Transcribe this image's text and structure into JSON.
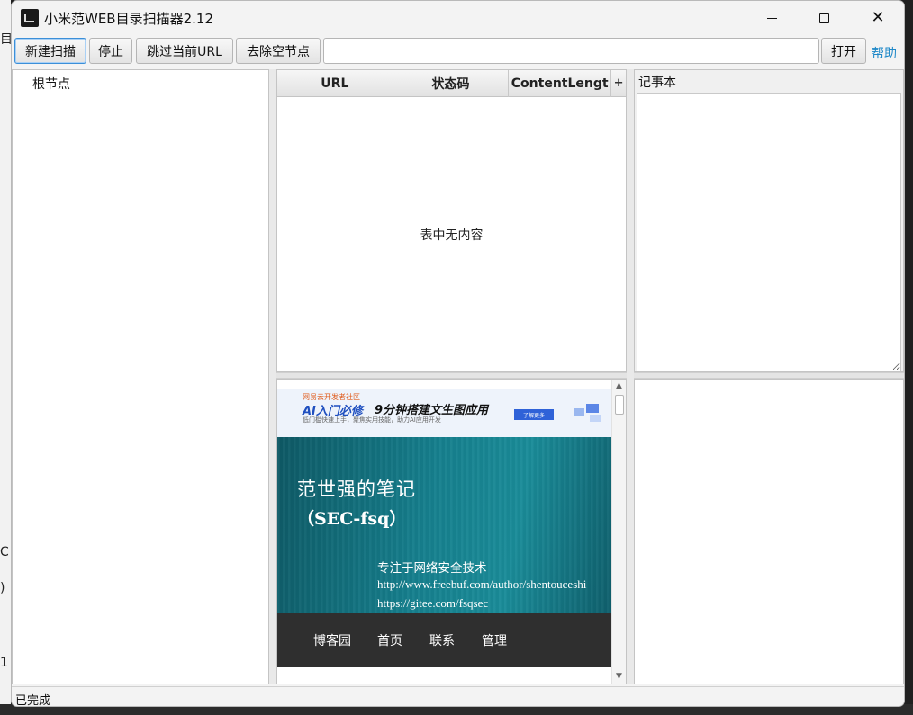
{
  "desktop": {
    "fragments": [
      "目",
      "C",
      ")",
      "1"
    ]
  },
  "window": {
    "title": "小米范WEB目录扫描器2.12",
    "controls": {
      "minimize": "minimize",
      "maximize": "maximize",
      "close": "close"
    }
  },
  "toolbar": {
    "new_scan": "新建扫描",
    "stop": "停止",
    "skip_url": "跳过当前URL",
    "remove_empty": "去除空节点",
    "url_value": "",
    "open": "打开",
    "help": "帮助"
  },
  "tree": {
    "root": "根节点"
  },
  "results_table": {
    "columns": [
      "URL",
      "状态码",
      "ContentLengt"
    ],
    "add_column": "+",
    "empty_message": "表中无内容",
    "rows": []
  },
  "preview": {
    "ad": {
      "tag": "网易云开发者社区",
      "ai_title": "AI入门必修",
      "main_title": "9分钟搭建文生图应用",
      "subtitle": "低门槛快速上手，聚焦实用技能，助力AI应用开发",
      "button": "了解更多"
    },
    "blog": {
      "title": "范世强的笔记",
      "subtitle": "（SEC-fsq）",
      "description": "专注于网络安全技术",
      "url1": "http://www.freebuf.com/author/shentouceshi",
      "url2": "https://gitee.com/fsqsec",
      "nav": [
        "博客园",
        "首页",
        "联系",
        "管理"
      ]
    },
    "colors": {
      "banner": "#16808e",
      "nav": "#2f2f2f"
    }
  },
  "notes": {
    "label": "记事本",
    "content": ""
  },
  "status": {
    "text": "已完成"
  },
  "colors": {
    "help_link": "#1e88c8",
    "focus_border": "#3b8fd8"
  }
}
